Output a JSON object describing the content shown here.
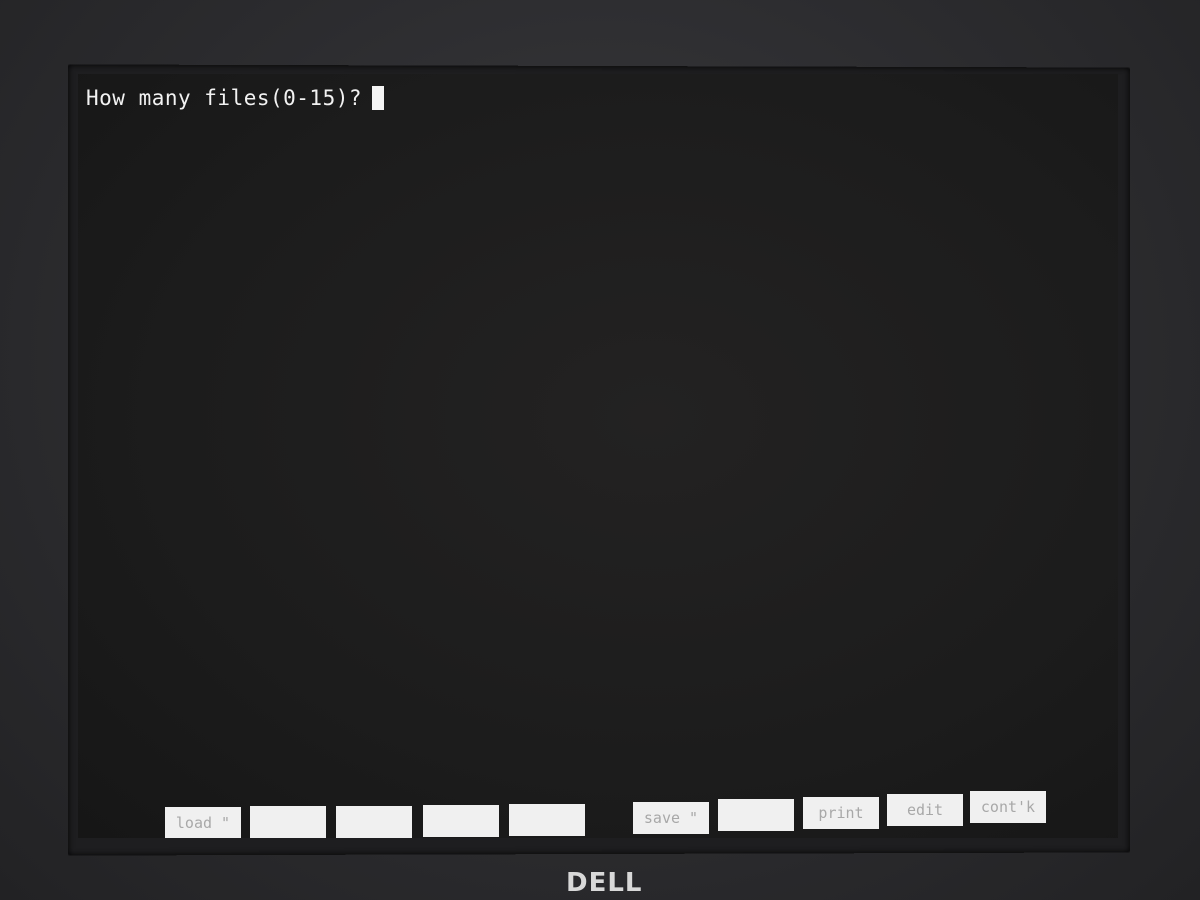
{
  "terminal": {
    "prompt": "How many files(0-15)?"
  },
  "softkeys": [
    {
      "id": "load",
      "label": "load \""
    },
    {
      "id": "f2",
      "label": ""
    },
    {
      "id": "f3",
      "label": ""
    },
    {
      "id": "f4",
      "label": ""
    },
    {
      "id": "f5",
      "label": ""
    },
    {
      "id": "save",
      "label": "save \""
    },
    {
      "id": "f7",
      "label": ""
    },
    {
      "id": "print",
      "label": "print"
    },
    {
      "id": "edit",
      "label": "edit"
    },
    {
      "id": "cont",
      "label": "cont'k"
    }
  ],
  "brand": {
    "logo_text": "DELL"
  }
}
